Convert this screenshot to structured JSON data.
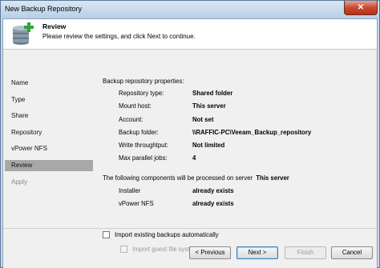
{
  "window": {
    "title": "New Backup Repository",
    "close_glyph": "✕"
  },
  "header": {
    "title": "Review",
    "subtitle": "Please review the settings, and click Next to continue."
  },
  "nav": {
    "items": [
      {
        "label": "Name"
      },
      {
        "label": "Type"
      },
      {
        "label": "Share"
      },
      {
        "label": "Repository"
      },
      {
        "label": "vPower NFS"
      },
      {
        "label": "Review"
      },
      {
        "label": "Apply"
      }
    ]
  },
  "review": {
    "properties_heading": "Backup repository properties:",
    "properties": [
      {
        "key": "Repository type:",
        "value": "Shared folder"
      },
      {
        "key": "Mount host:",
        "value": "This server"
      },
      {
        "key": "Account:",
        "value": "Not set"
      },
      {
        "key": "Backup folder:",
        "value": "\\\\RAFFIC-PC\\Veeam_Backup_repository"
      },
      {
        "key": "Write throughtput:",
        "value": "Not limited"
      },
      {
        "key": "Max parallel jobs:",
        "value": "4"
      }
    ],
    "components_heading": "The following components will be processed on server",
    "components_server": "This server",
    "components": [
      {
        "key": "Installer",
        "value": "already exists"
      },
      {
        "key": "vPower NFS",
        "value": "already exists"
      }
    ],
    "import_backups_label": "Import existing backups automatically",
    "import_index_label": "Import guest file system index"
  },
  "buttons": {
    "previous": "< Previous",
    "next": "Next >",
    "finish": "Finish",
    "cancel": "Cancel"
  },
  "colors": {
    "active_nav": "#a8a8a8",
    "default_button_border": "#3c7fb1"
  }
}
